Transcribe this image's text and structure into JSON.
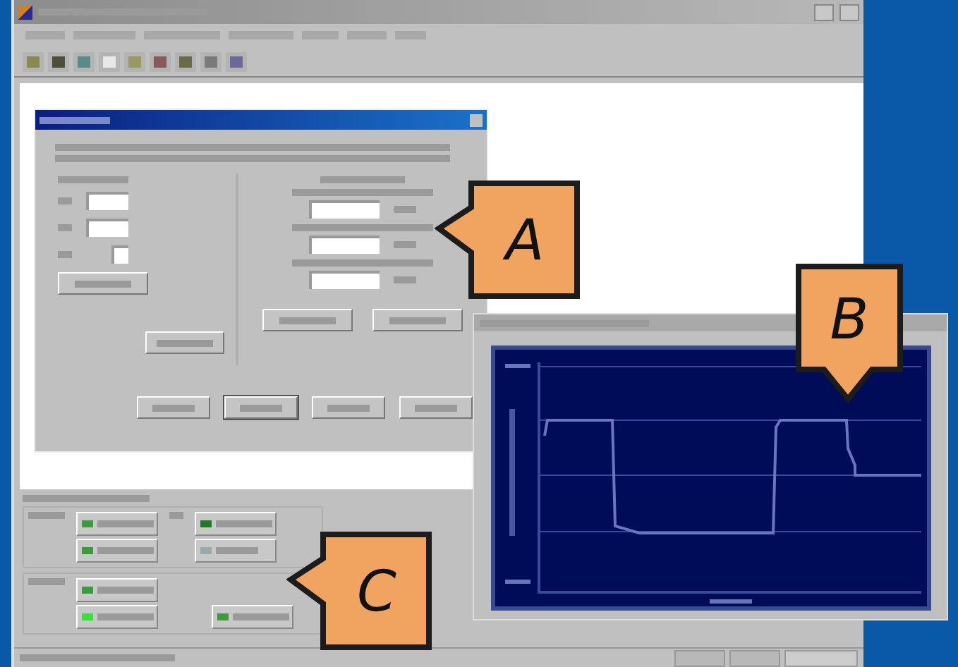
{
  "callouts": [
    {
      "label": "A",
      "kind": "left"
    },
    {
      "label": "B",
      "kind": "down"
    },
    {
      "label": "C",
      "kind": "left"
    }
  ]
}
